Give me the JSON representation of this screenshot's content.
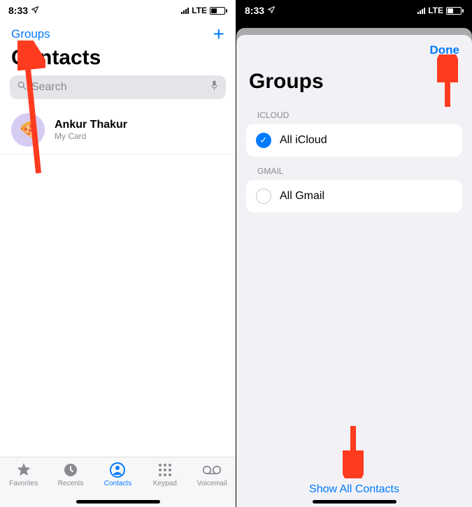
{
  "status": {
    "time": "8:33",
    "network": "LTE"
  },
  "left": {
    "nav": {
      "groups": "Groups"
    },
    "title": "Contacts",
    "search": {
      "placeholder": "Search"
    },
    "me": {
      "name": "Ankur Thakur",
      "subtitle": "My Card",
      "avatar_emoji": "🍕"
    },
    "tabs": {
      "favorites": "Favorites",
      "recents": "Recents",
      "contacts": "Contacts",
      "keypad": "Keypad",
      "voicemail": "Voicemail"
    }
  },
  "right": {
    "done": "Done",
    "title": "Groups",
    "sections": {
      "icloud_header": "ICLOUD",
      "icloud_item": "All iCloud",
      "gmail_header": "GMAIL",
      "gmail_item": "All Gmail"
    },
    "show_all": "Show All Contacts"
  },
  "colors": {
    "accent": "#007aff",
    "arrow": "#ff3b1f"
  }
}
